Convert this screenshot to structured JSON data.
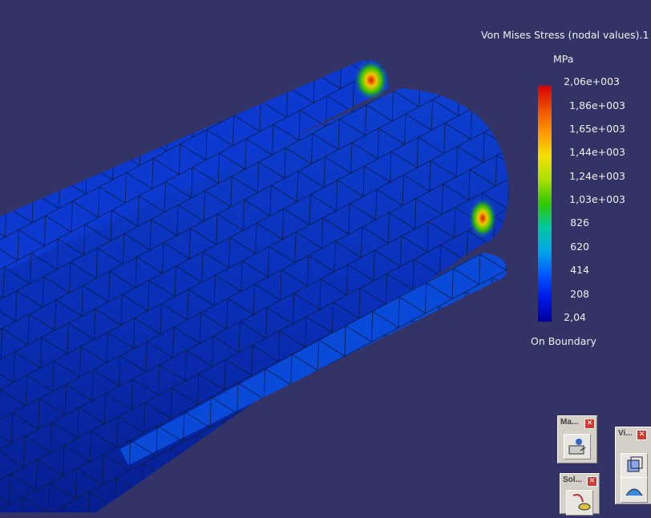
{
  "legend": {
    "title": "Von Mises Stress (nodal values).1",
    "unit": "MPa",
    "ticks": [
      "2,06e+003",
      "1,86e+003",
      "1,65e+003",
      "1,44e+003",
      "1,24e+003",
      "1,03e+003",
      "826",
      "620",
      "414",
      "208",
      "2,04"
    ],
    "footer": "On Boundary"
  },
  "toolbars": {
    "manage": {
      "title": "Ma...",
      "close": "✕",
      "icon": "manage-solutions-icon"
    },
    "solve": {
      "title": "Sol...",
      "close": "✕",
      "icon": "compute-icon"
    },
    "view": {
      "title": "Vi...",
      "close": "✕",
      "icons": [
        "view-mode-icon",
        "render-style-icon"
      ]
    }
  },
  "colors": {
    "background": "#333366",
    "mesh_edges": "#0a1a3a"
  }
}
